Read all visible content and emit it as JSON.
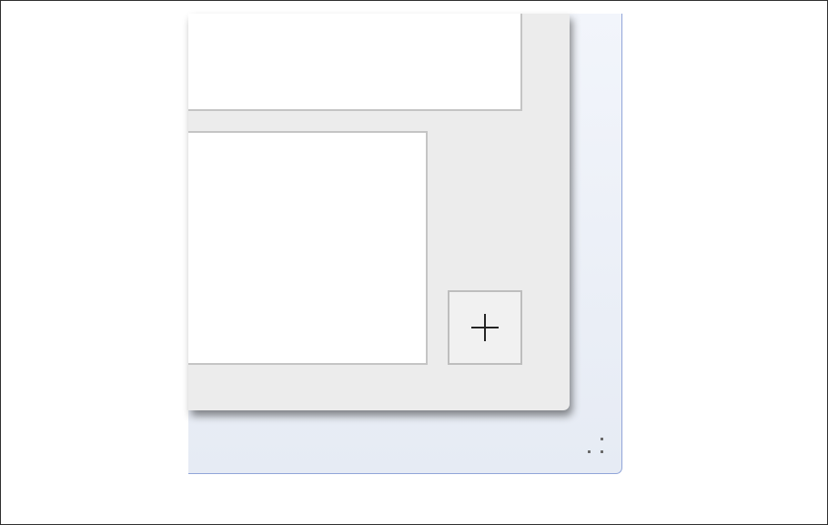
{
  "dialog": {
    "add_button": {
      "icon": "plus-icon"
    }
  },
  "window": {
    "resize_grip": {
      "icon": "resize-grip-icon"
    }
  },
  "colors": {
    "dialog_background": "#ececec",
    "pane_background": "#ffffff",
    "pane_border": "#c4c4c4",
    "window_border": "#8fa3d8"
  }
}
